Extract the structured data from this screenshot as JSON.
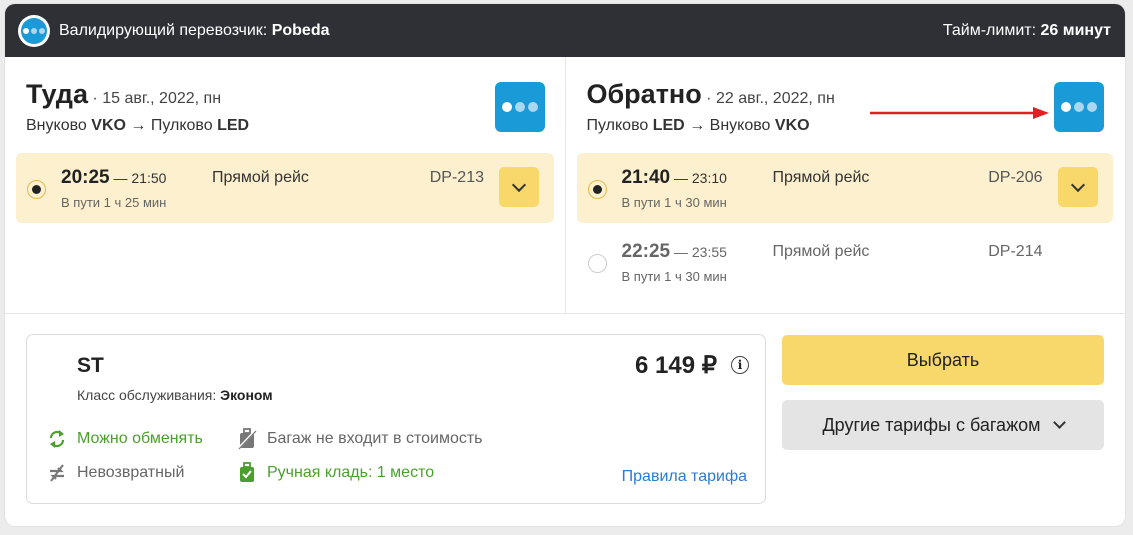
{
  "topbar": {
    "carrier_label": "Валидирующий перевозчик:",
    "carrier_name": "Pobeda",
    "time_limit_label": "Тайм-лимит:",
    "time_limit_value": "26 минут",
    "logo_icon": "pobeda-logo-icon"
  },
  "outbound": {
    "title": "Туда",
    "date": "· 15 авг., 2022, пн",
    "from_city": "Внуково",
    "from_code": "VKO",
    "arrow": "→",
    "to_city": "Пулково",
    "to_code": "LED",
    "flights": [
      {
        "dep": "20:25",
        "sep": "—",
        "arr": "21:50",
        "duration": "В пути 1 ч 25 мин",
        "type": "Прямой рейс",
        "number": "DP-213",
        "selected": true
      }
    ]
  },
  "return": {
    "title": "Обратно",
    "date": "· 22 авг., 2022, пн",
    "from_city": "Пулково",
    "from_code": "LED",
    "arrow": "→",
    "to_city": "Внуково",
    "to_code": "VKO",
    "flights": [
      {
        "dep": "21:40",
        "sep": "—",
        "arr": "23:10",
        "duration": "В пути 1 ч 30 мин",
        "type": "Прямой рейс",
        "number": "DP-206",
        "selected": true
      },
      {
        "dep": "22:25",
        "sep": "—",
        "arr": "23:55",
        "duration": "В пути 1 ч 30 мин",
        "type": "Прямой рейс",
        "number": "DP-214",
        "selected": false
      }
    ]
  },
  "tariff": {
    "name": "ST",
    "price": "6 149 ₽",
    "class_label": "Класс обслуживания:",
    "class_value": "Эконом",
    "features": {
      "exchange": "Можно обменять",
      "refund": "Невозвратный",
      "baggage": "Багаж не входит в стоимость",
      "hand_luggage": "Ручная кладь: 1 место"
    },
    "rules_link": "Правила тарифа"
  },
  "actions": {
    "choose": "Выбрать",
    "other_tariffs": "Другие тарифы с багажом"
  },
  "colors": {
    "accent_yellow": "#f8d86a",
    "selected_bg": "#fdf0cf",
    "brand_blue": "#1a9ad6",
    "green": "#4aa02c",
    "link_blue": "#2a7bd3",
    "arrow_red": "#e31e24"
  }
}
